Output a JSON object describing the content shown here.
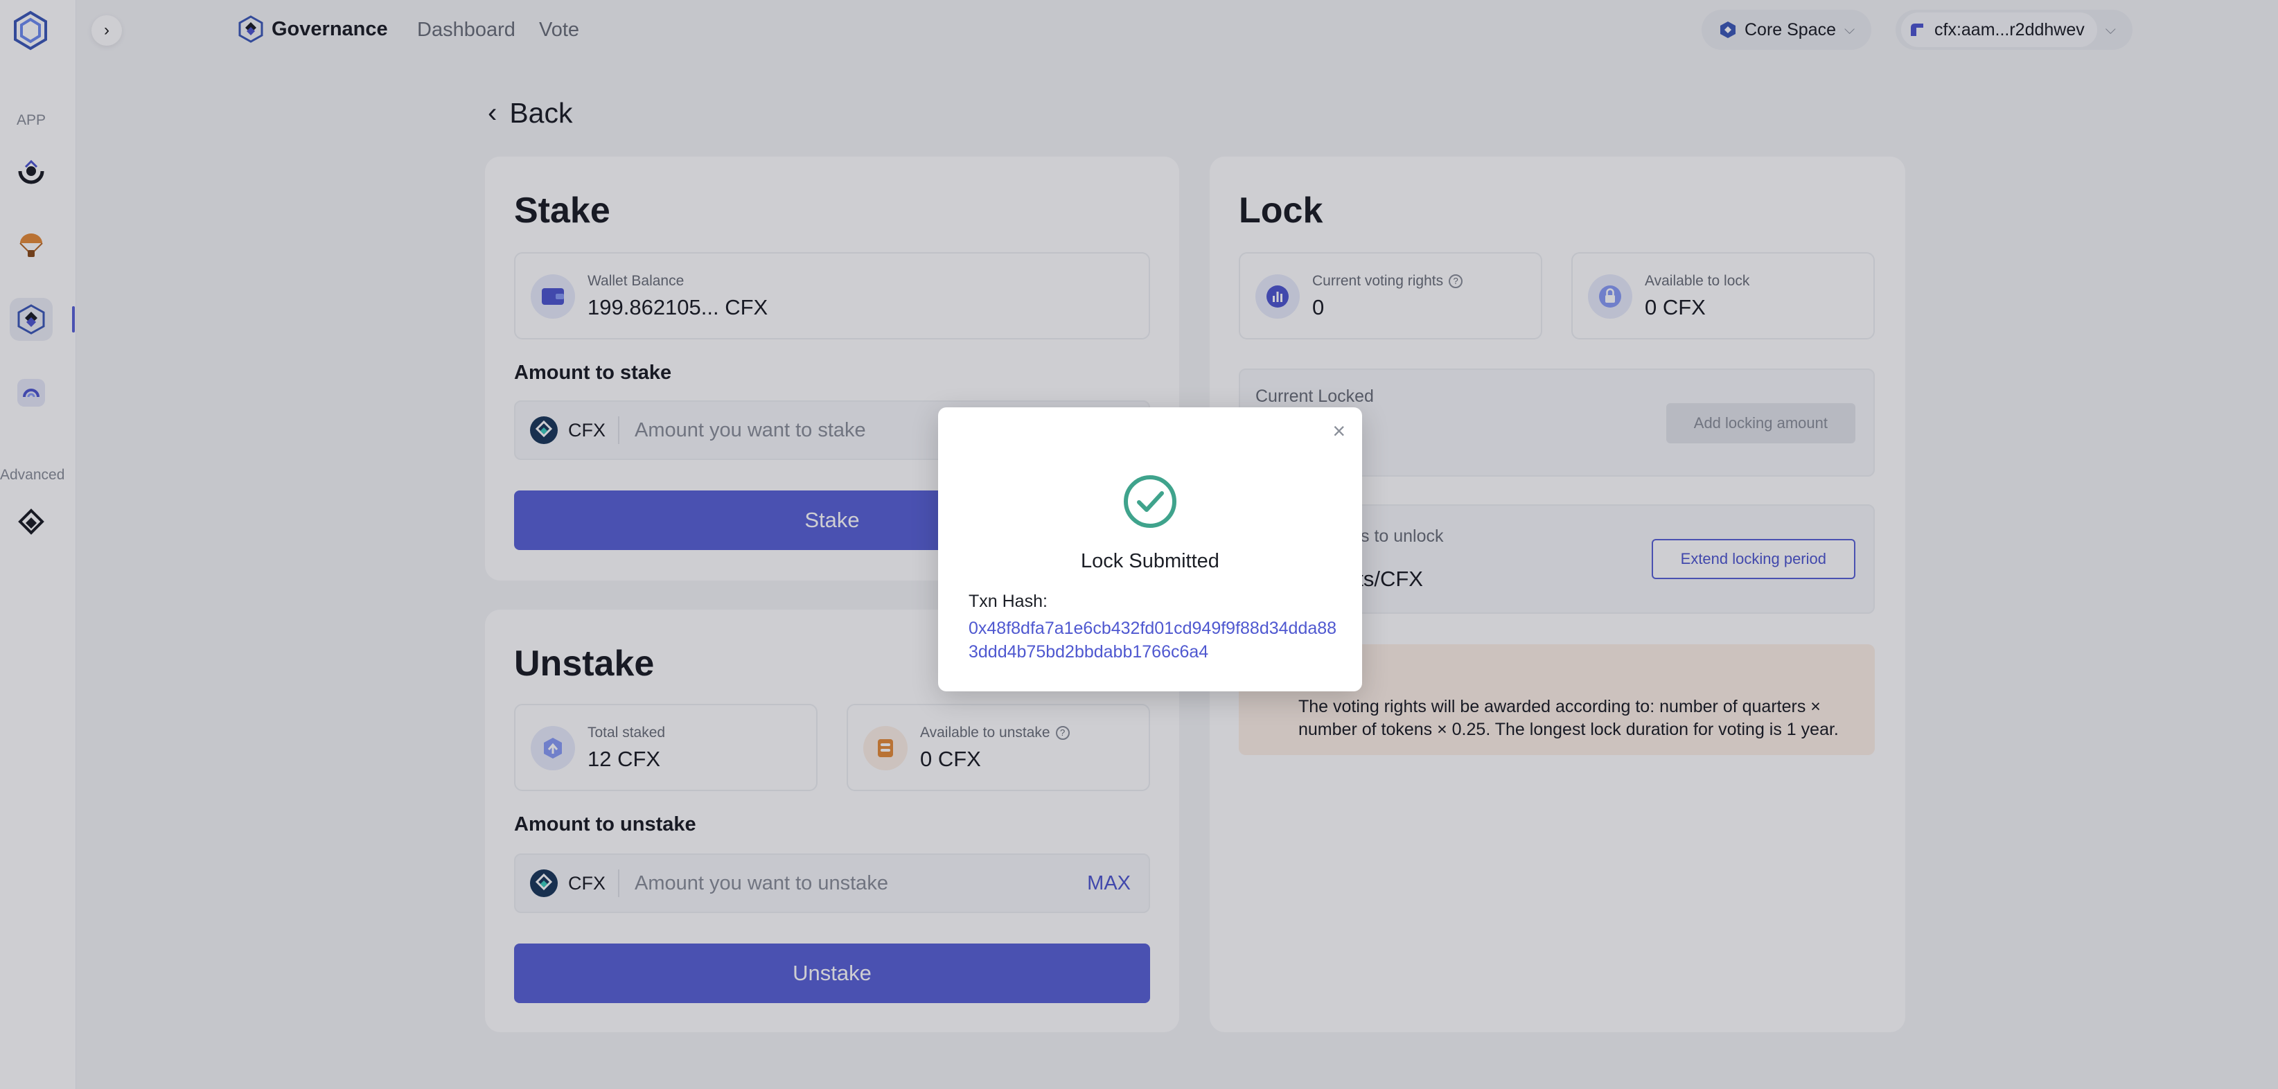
{
  "sidebar": {
    "app_label": "APP",
    "advanced_label": "Advanced"
  },
  "header": {
    "brand": "Governance",
    "nav": [
      "Dashboard",
      "Vote"
    ],
    "network": "Core Space",
    "account": "cfx:aam...r2ddhwev"
  },
  "back_label": "Back",
  "stake": {
    "title": "Stake",
    "wallet_balance_label": "Wallet Balance",
    "wallet_balance_value": "199.862105... CFX",
    "amount_label": "Amount to stake",
    "token": "CFX",
    "input_placeholder": "Amount you want to stake",
    "button": "Stake"
  },
  "unstake": {
    "title": "Unstake",
    "total_staked_label": "Total staked",
    "total_staked_value": "12 CFX",
    "available_label": "Available to unstake",
    "available_value": "0 CFX",
    "amount_label": "Amount to unstake",
    "token": "CFX",
    "input_placeholder": "Amount you want to unstake",
    "max": "MAX",
    "button": "Unstake"
  },
  "lock": {
    "title": "Lock",
    "voting_rights_label": "Current voting rights",
    "voting_rights_value": "0",
    "available_label": "Available to lock",
    "available_value": "0 CFX",
    "current_locked_label": "Current Locked",
    "add_locking_button": "Add locking amount",
    "unlock_label_partial": "s to unlock",
    "unlock_value_partial": "nts/CFX",
    "extend_button": "Extend locking period",
    "notice": "The voting rights will be awarded according to: number of quarters × number of tokens × 0.25. The longest lock duration for voting is 1 year."
  },
  "modal": {
    "title": "Lock Submitted",
    "hash_label": "Txn Hash:",
    "hash_value": "0x48f8dfa7a1e6cb432fd01cd949f9f88d34dda883ddd4b75bd2bbdabb1766c6a4"
  },
  "colors": {
    "accent": "#5b63d6",
    "success": "#3fa38c",
    "notice_bg": "#fdf1e6"
  }
}
